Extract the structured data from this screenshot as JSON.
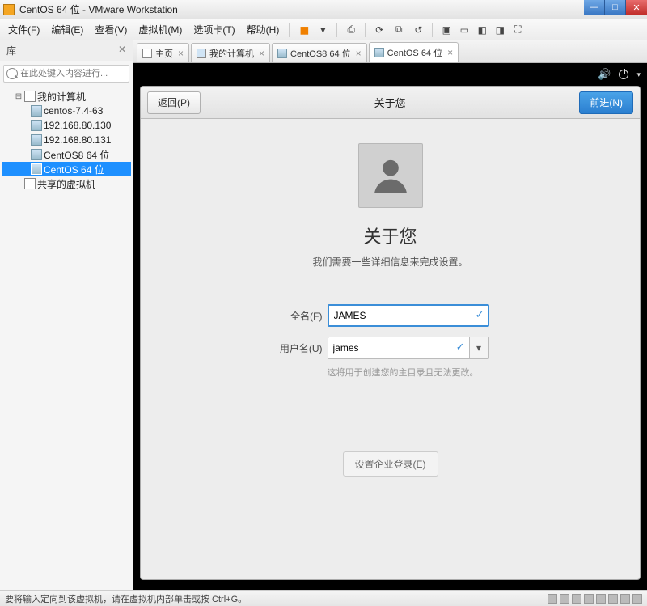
{
  "window": {
    "title": "CentOS 64 位 - VMware Workstation"
  },
  "menu": {
    "file": "文件(F)",
    "edit": "编辑(E)",
    "view": "查看(V)",
    "vm": "虚拟机(M)",
    "tabs": "选项卡(T)",
    "help": "帮助(H)"
  },
  "sidebar": {
    "header": "库",
    "search_placeholder": "在此处键入内容进行...",
    "root": "我的计算机",
    "items": [
      {
        "label": "centos-7.4-63"
      },
      {
        "label": "192.168.80.130"
      },
      {
        "label": "192.168.80.131"
      },
      {
        "label": "CentOS8 64 位"
      },
      {
        "label": "CentOS 64 位"
      }
    ],
    "shared": "共享的虚拟机"
  },
  "tabs": [
    {
      "label": "主页",
      "icon": "home"
    },
    {
      "label": "我的计算机",
      "icon": "mon"
    },
    {
      "label": "CentOS8 64 位",
      "icon": "vm"
    },
    {
      "label": "CentOS 64 位",
      "icon": "vm",
      "active": true
    }
  ],
  "gnome": {
    "back": "返回(P)",
    "next": "前进(N)",
    "title": "关于您",
    "heading": "关于您",
    "subheading": "我们需要一些详细信息来完成设置。",
    "fullname_label": "全名(F)",
    "fullname_value": "JAMES",
    "username_label": "用户名(U)",
    "username_value": "james",
    "username_note": "这将用于创建您的主目录且无法更改。",
    "enterprise": "设置企业登录(E)"
  },
  "status": {
    "text": "要将输入定向到该虚拟机，请在虚拟机内部单击或按 Ctrl+G。"
  }
}
